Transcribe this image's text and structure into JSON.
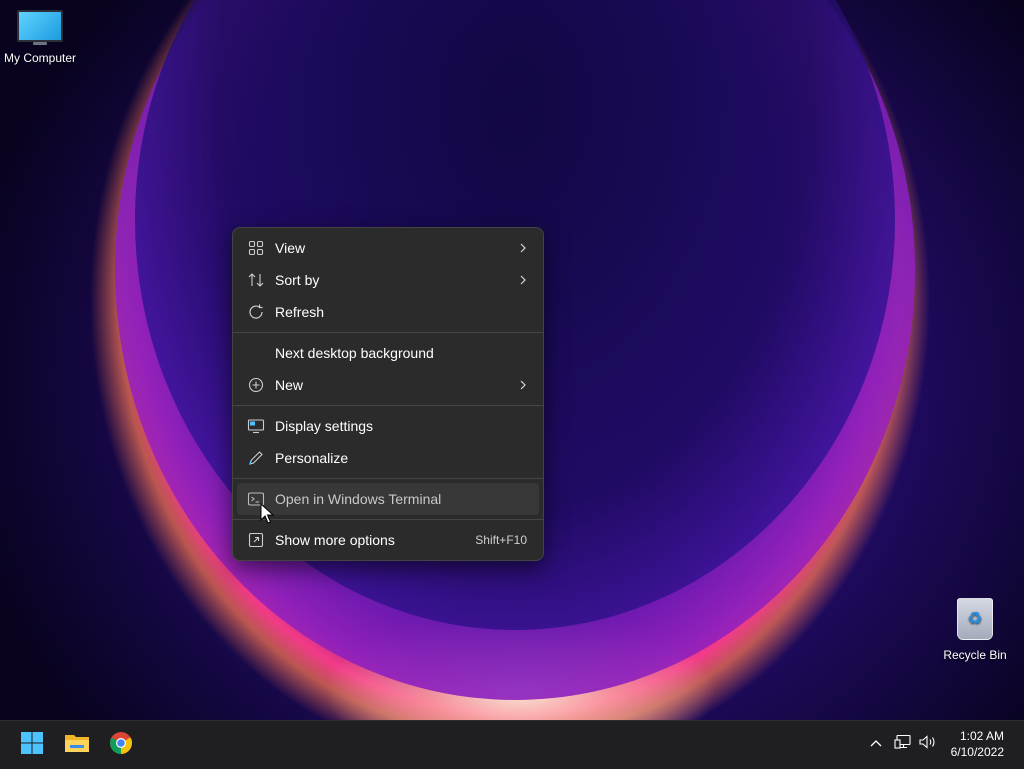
{
  "desktop": {
    "icons": [
      {
        "label": "My Computer",
        "icon": "monitor-icon"
      },
      {
        "label": "Recycle Bin",
        "icon": "recycle-bin-icon"
      }
    ]
  },
  "context_menu": {
    "items": [
      {
        "label": "View",
        "icon": "grid-view-icon",
        "submenu": true
      },
      {
        "label": "Sort by",
        "icon": "sort-icon",
        "submenu": true
      },
      {
        "label": "Refresh",
        "icon": "refresh-icon"
      },
      {
        "label": "Next desktop background"
      },
      {
        "label": "New",
        "icon": "plus-circle-icon",
        "submenu": true
      },
      {
        "label": "Display settings",
        "icon": "display-icon"
      },
      {
        "label": "Personalize",
        "icon": "pen-icon"
      },
      {
        "label": "Open in Windows Terminal",
        "icon": "terminal-icon",
        "hovered": true
      },
      {
        "label": "Show more options",
        "icon": "show-more-icon",
        "shortcut": "Shift+F10"
      }
    ]
  },
  "taskbar": {
    "pinned": [
      "windows-start-icon",
      "file-explorer-icon",
      "chrome-icon"
    ],
    "tray": [
      "chevron-up-icon",
      "network-icon",
      "volume-icon"
    ],
    "clock": {
      "time": "1:02 AM",
      "date": "6/10/2022"
    }
  },
  "colors": {
    "menu_bg": "#2b2b2b",
    "menu_hover": "#383838",
    "taskbar_bg": "#1f1f22",
    "accent_blue": "#4cc2ff"
  }
}
